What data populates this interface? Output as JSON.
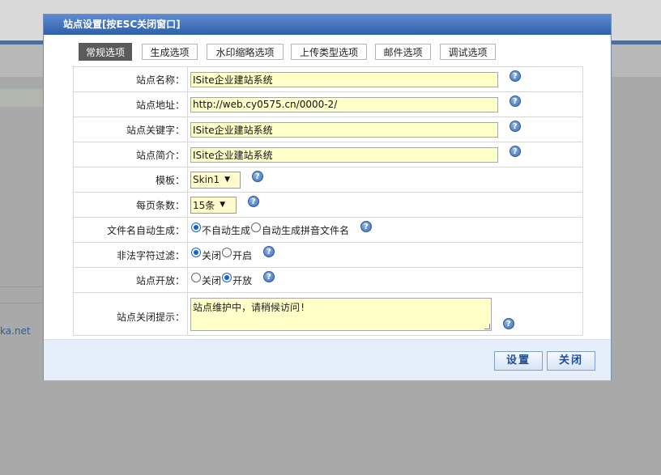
{
  "background": {
    "partial_link": "ka.net"
  },
  "dialog": {
    "title": "站点设置[按ESC关闭窗口]",
    "tabs": [
      {
        "label": "常规选项",
        "active": true
      },
      {
        "label": "生成选项",
        "active": false
      },
      {
        "label": "水印缩略选项",
        "active": false
      },
      {
        "label": "上传类型选项",
        "active": false
      },
      {
        "label": "邮件选项",
        "active": false
      },
      {
        "label": "调试选项",
        "active": false
      }
    ],
    "fields": {
      "site_name": {
        "label": "站点名称：",
        "value": "ISite企业建站系统"
      },
      "site_url": {
        "label": "站点地址：",
        "value": "http://web.cy0575.cn/0000-2/"
      },
      "site_keywords": {
        "label": "站点关键字：",
        "value": "ISite企业建站系统"
      },
      "site_intro": {
        "label": "站点简介：",
        "value": "ISite企业建站系统"
      },
      "template": {
        "label": "模板：",
        "value": "Skin1"
      },
      "page_size": {
        "label": "每页条数：",
        "value": "15条"
      },
      "filename_auto": {
        "label": "文件名自动生成：",
        "options": [
          "不自动生成",
          "自动生成拼音文件名"
        ],
        "selected": "不自动生成"
      },
      "illegal_filter": {
        "label": "非法字符过滤：",
        "options": [
          "关闭",
          "开启"
        ],
        "selected": "关闭"
      },
      "site_open": {
        "label": "站点开放：",
        "options": [
          "关闭",
          "开放"
        ],
        "selected": "开放"
      },
      "close_notice": {
        "label": "站点关闭提示：",
        "value": "站点维护中，请稍候访问!"
      }
    },
    "help_glyph": "?",
    "buttons": {
      "save": "设置",
      "close": "关闭"
    }
  },
  "colors": {
    "overlay": "#a9a9a9",
    "title_bar": "#2f5fab",
    "input_bg": "#ffffc8",
    "footer_bg": "#e6eef9",
    "button_text": "#1f4c90"
  },
  "icons": {
    "help": "help-icon",
    "select_arrow": "chevron-down-icon",
    "radio": "radio-button"
  }
}
